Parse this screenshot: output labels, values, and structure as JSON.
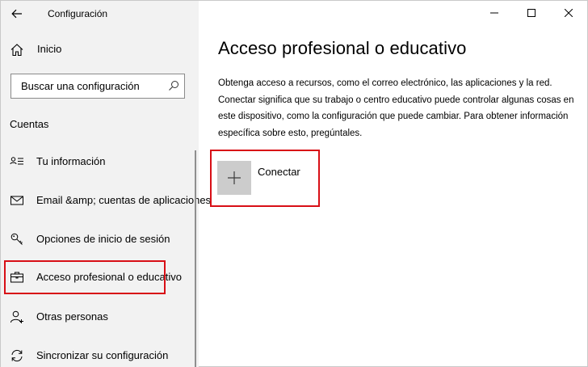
{
  "window": {
    "title": "Configuración",
    "caption": {
      "minimize": "minimize-icon",
      "maximize": "maximize-icon",
      "close": "close-icon"
    }
  },
  "sidebar": {
    "home": {
      "label": "Inicio",
      "icon": "home-icon"
    },
    "search": {
      "placeholder": "Buscar una configuración",
      "value": "",
      "icon": "search-icon"
    },
    "section": "Cuentas",
    "items": [
      {
        "label": "Tu información",
        "icon": "person-card-icon"
      },
      {
        "label": "Email &amp; cuentas de aplicaciones",
        "icon": "mail-icon"
      },
      {
        "label": "Opciones de inicio de sesión",
        "icon": "key-icon"
      },
      {
        "label": "Acceso profesional o educativo",
        "icon": "briefcase-icon",
        "selected": true
      },
      {
        "label": "Otras personas",
        "icon": "person-add-icon"
      },
      {
        "label": "Sincronizar su configuración",
        "icon": "sync-icon"
      }
    ]
  },
  "main": {
    "title": "Acceso profesional o educativo",
    "description": "Obtenga acceso a recursos, como el correo electrónico, las aplicaciones y la red. Conectar significa que su trabajo o centro educativo puede controlar algunas cosas en este dispositivo, como la configuración que puede cambiar. Para obtener información específica sobre esto, pregúntales.",
    "connect": {
      "label": "Conectar",
      "icon": "plus-icon"
    }
  },
  "colors": {
    "sidebar_bg": "#f2f2f2",
    "highlight": "#d80f16",
    "tile": "#cccccc"
  }
}
